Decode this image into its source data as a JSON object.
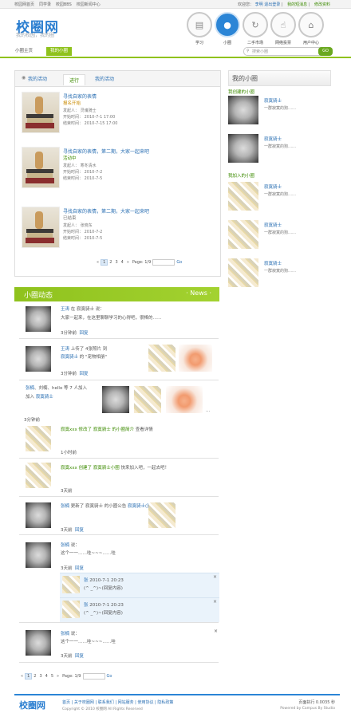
{
  "topbar": {
    "left": [
      "校园网首页",
      "同学录",
      "校园BBS",
      "校园新闻中心"
    ],
    "welcome": "欢迎您：",
    "user": "李明",
    "logout": "退出登录",
    "sep": "|",
    "links": [
      "我的短消息",
      "修改资料"
    ]
  },
  "header": {
    "logo": "校圈网",
    "slogan": "我的校园，我的圈"
  },
  "nav": [
    {
      "label": "学习",
      "icon": "book-icon"
    },
    {
      "label": "小圈",
      "icon": "people-icon"
    },
    {
      "label": "二手市场",
      "icon": "exchange-icon"
    },
    {
      "label": "网络投票",
      "icon": "thumb-icon"
    },
    {
      "label": "用户中心",
      "icon": "home-icon"
    }
  ],
  "subnav": {
    "tabs": [
      "小圈主页",
      "我的小圈"
    ],
    "search_placeholder": "搜索小圈",
    "search_go": "GO"
  },
  "activities": {
    "tab_title": "我的活动",
    "tabs": [
      "进行",
      "我的活动"
    ],
    "items": [
      {
        "title": "寻找自家的表情",
        "status": "报名开始",
        "meta": [
          "发起人：  灵魂骑士",
          "开始时间：  2010-7-1 17:00",
          "结束时间：  2010-7-15 17:00"
        ]
      },
      {
        "title": "寻找自家的表情，第二期，大家一起来吧",
        "status": "活动中",
        "meta": [
          "发起人：  寒冬清水",
          "开始时间：  2010-7-2",
          "结束时间：  2010-7-5"
        ]
      },
      {
        "title": "寻找自家的表情，第二期，大家一起来吧",
        "status": "已结束",
        "meta": [
          "发起人：  张晓东",
          "开始时间：  2010-7-2",
          "结束时间：  2010-7-5"
        ]
      }
    ],
    "pager": {
      "prev": "«",
      "pages": [
        "1",
        "2",
        "3",
        "4"
      ],
      "next": "»",
      "info": "Page: 1/9",
      "go": "Go"
    }
  },
  "right": {
    "title": "我的小圈",
    "created_label": "我创建的小圈",
    "joined_label": "我加入的小圈",
    "created": [
      {
        "name": "寂寞骑士",
        "desc": "一群寂寞的狗……"
      },
      {
        "name": "寂寞骑士",
        "desc": "一群寂寞的狗……"
      }
    ],
    "joined": [
      {
        "name": "寂寞骑士",
        "desc": "一群寂寞的狗……"
      },
      {
        "name": "寂寞骑士",
        "desc": "一群寂寞的狗……"
      },
      {
        "name": "寂寞骑士",
        "desc": "一群寂寞的狗……"
      }
    ]
  },
  "news": {
    "title": "小圈动态",
    "more": "· News ·",
    "feed": [
      {
        "line1_user": "王涛",
        "line1_rest": "在 寂寞骑士 说：",
        "line2": "大家一起来，在这里聊聊学习的心得吧，很棒的……",
        "time": "3分钟前",
        "reply": "回复"
      },
      {
        "line1_user": "王涛",
        "line1_rest": "上传了 4张照片 到",
        "line2_group": "寂寞骑士",
        "line2_rest": "的 \"宠物相册\"",
        "time": "3分钟前",
        "reply": "回复"
      },
      {
        "line1_user": "张楠",
        "line1_rest": "、刘楠、hello 等 7 人加入",
        "line2_pre": "加入",
        "line2_group": "寂寞骑士",
        "time": "3分钟前",
        "more": "..."
      },
      {
        "line1": "寂寞xxx 修改了 寂寞骑士 的小圈简介 ",
        "line1_tail": "查看详情",
        "time": "1小时前"
      },
      {
        "line1": "寂寞xxx 创建了 寂寞骑士小圈 ",
        "line1_tail": "快来加入吧，一起去吧！",
        "time": "3天前"
      },
      {
        "line1_user": "张楠",
        "line1_rest": "更新了 寂寞骑士 的小圈公告 ",
        "line1_tail": "寂寞骑士(更新的公告)",
        "time": "3天前",
        "reply": "回复"
      },
      {
        "line1_user": "张楠",
        "line1_rest": "说：",
        "line2": "这个一一……哇~~~……哇",
        "time": "3天前",
        "reply": "回复",
        "replies": [
          {
            "user": "张",
            "date": "2010-7-1 20:23",
            "text": "(^ _^)~(回复内容)"
          },
          {
            "user": "张",
            "date": "2010-7-1 20:23",
            "text": "(^ _^)~(回复内容)"
          }
        ]
      },
      {
        "line1_user": "张楠",
        "line1_rest": "说：",
        "line2": "这个一一……哇~~~……哇",
        "time": "3天前",
        "reply": "回复"
      }
    ],
    "pager": {
      "prev": "«",
      "pages": [
        "1",
        "2",
        "3",
        "4",
        "5"
      ],
      "next": "»",
      "info": "Page: 1/9",
      "go": "Go"
    }
  },
  "footer": {
    "logo": "校圈网",
    "links": "首页 | 关于校圈网 | 联系我们 | 网站服务 | 使用协议 | 隐私政策",
    "copy": "Copyright © 2010 校圈网 All Rights Reserved",
    "right1": "页面执行 0.0035 秒",
    "right2": "Powered by Campus By Studio"
  },
  "colors": {
    "accent_blue": "#2b85d6",
    "accent_green": "#8fc21d",
    "link": "#2a6fb3"
  }
}
